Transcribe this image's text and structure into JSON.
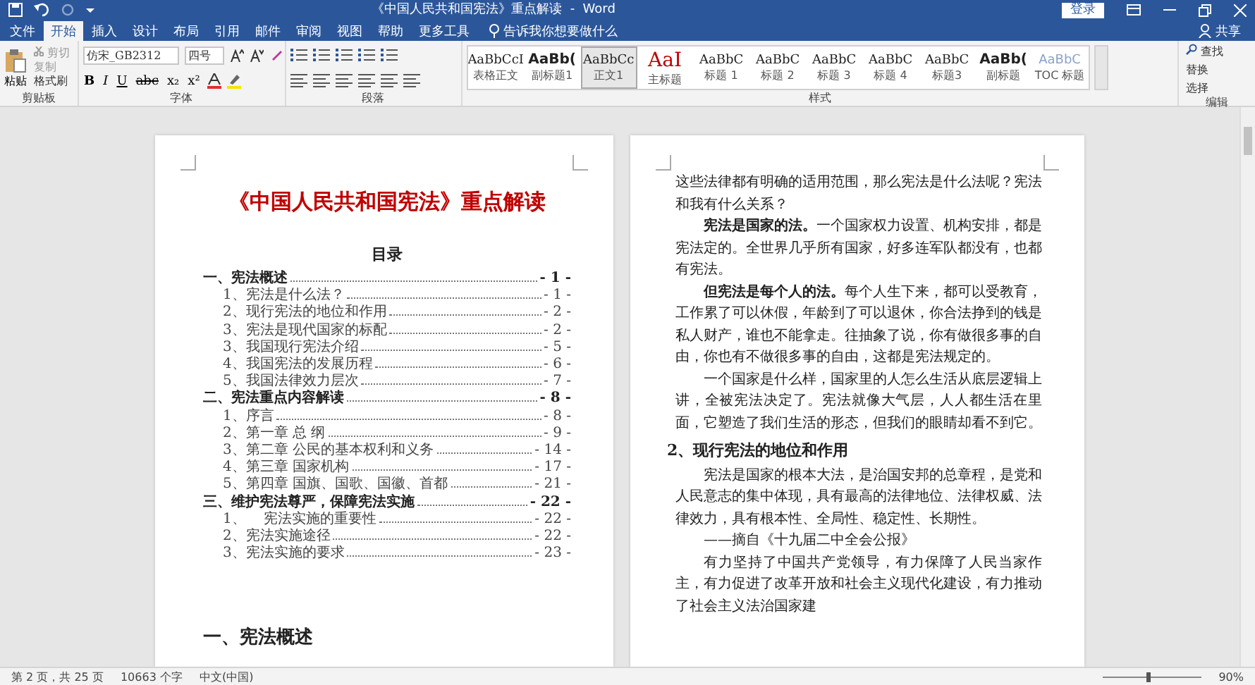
{
  "title_bar": {
    "title": "《中国人民共和国宪法》重点解读  -  Word",
    "login": "登录"
  },
  "tabs": [
    {
      "label": "文件",
      "selected": false
    },
    {
      "label": "开始",
      "selected": true
    },
    {
      "label": "插入",
      "selected": false
    },
    {
      "label": "设计",
      "selected": false
    },
    {
      "label": "布局",
      "selected": false
    },
    {
      "label": "引用",
      "selected": false
    },
    {
      "label": "邮件",
      "selected": false
    },
    {
      "label": "审阅",
      "selected": false
    },
    {
      "label": "视图",
      "selected": false
    },
    {
      "label": "帮助",
      "selected": false
    },
    {
      "label": "更多工具",
      "selected": false
    }
  ],
  "tell_me": "告诉我你想要做什么",
  "share": "共享",
  "ribbon": {
    "clipboard": {
      "paste": "粘贴",
      "cut": "剪切",
      "copy": "复制",
      "format_painter": "格式刷",
      "label": "剪贴板"
    },
    "font": {
      "name": "仿宋_GB2312",
      "size": "四号",
      "buttons": [
        "B",
        "I",
        "U",
        "abc",
        "x₂",
        "x²"
      ],
      "label": "字体"
    },
    "paragraph": {
      "label": "段落"
    },
    "styles": {
      "label": "样式",
      "items": [
        {
          "sample": "AaBbCcI",
          "name": "表格正文",
          "selected": false
        },
        {
          "sample": "AaBb(",
          "name": "副标题1",
          "selected": false
        },
        {
          "sample": "AaBbCc",
          "name": "正文1",
          "selected": true
        },
        {
          "sample": "AaI",
          "name": "主标题",
          "selected": false
        },
        {
          "sample": "AaBbC",
          "name": "标题 1",
          "selected": false
        },
        {
          "sample": "AaBbC",
          "name": "标题 2",
          "selected": false
        },
        {
          "sample": "AaBbC",
          "name": "标题 3",
          "selected": false
        },
        {
          "sample": "AaBbC",
          "name": "标题 4",
          "selected": false
        },
        {
          "sample": "AaBbC",
          "name": "标题3",
          "selected": false
        },
        {
          "sample": "AaBb(",
          "name": "副标题",
          "selected": false
        },
        {
          "sample": "AaBbC",
          "name": "TOC 标题",
          "selected": false
        }
      ]
    },
    "editing": {
      "find": "查找",
      "replace": "替换",
      "select": "选择",
      "label": "编辑"
    }
  },
  "left_page": {
    "title": "《中国人民共和国宪法》重点解读",
    "toc_heading": "目录",
    "toc": [
      {
        "text": "一、宪法概述",
        "page": "- 1 -",
        "children": [
          {
            "text": "1、宪法是什么法？",
            "page": "- 1 -"
          },
          {
            "text": "2、现行宪法的地位和作用",
            "page": "- 2 -"
          },
          {
            "text": "3、宪法是现代国家的标配",
            "page": "- 2 -"
          },
          {
            "text": "3、我国现行宪法介绍",
            "page": "- 5 -"
          },
          {
            "text": "4、我国宪法的发展历程",
            "page": "- 6 -"
          },
          {
            "text": "5、我国法律效力层次",
            "page": "- 7 -"
          }
        ]
      },
      {
        "text": "二、宪法重点内容解读",
        "page": "- 8 -",
        "children": [
          {
            "text": "1、序言",
            "page": "- 8 -"
          },
          {
            "text": "2、第一章 总 纲",
            "page": "- 9 -"
          },
          {
            "text": "3、第二章 公民的基本权利和义务",
            "page": "- 14 -"
          },
          {
            "text": "4、第三章 国家机构",
            "page": "- 17 -"
          },
          {
            "text": "5、第四章 国旗、国歌、国徽、首都",
            "page": "- 21 -"
          }
        ]
      },
      {
        "text": "三、维护宪法尊严，保障宪法实施",
        "page": "- 22 -",
        "children": [
          {
            "text": "1、    宪法实施的重要性",
            "page": "- 22 -"
          },
          {
            "text": "2、宪法实施途径",
            "page": "- 22 -"
          },
          {
            "text": "3、宪法实施的要求",
            "page": "- 23 -"
          }
        ]
      }
    ],
    "section_heading": "一、宪法概述"
  },
  "right_page": {
    "paragraphs": [
      {
        "kind": "continuation",
        "text": "这些法律都有明确的适用范围，那么宪法是什么法呢？宪法和我有什么关系？"
      },
      {
        "kind": "body",
        "text": "**宪法是国家的法。**一个国家权力设置、机构安排，都是宪法定的。全世界几乎所有国家，好多连军队都没有，也都有宪法。"
      },
      {
        "kind": "body",
        "text": "**但宪法是每个人的法。**每个人生下来，都可以受教育，工作累了可以休假，年龄到了可以退休，你合法挣到的钱是私人财产，谁也不能拿走。往抽象了说，你有做很多事的自由，你也有不做很多事的自由，这都是宪法规定的。"
      },
      {
        "kind": "body",
        "text": "一个国家是什么样，国家里的人怎么生活从底层逻辑上讲，全被宪法决定了。宪法就像大气层，人人都生活在里面，它塑造了我们生活的形态，但我们的眼睛却看不到它。"
      },
      {
        "kind": "heading",
        "text": "2、现行宪法的地位和作用"
      },
      {
        "kind": "body",
        "text": "宪法是国家的根本大法，是治国安邦的总章程，是党和人民意志的集中体现，具有最高的法律地位、法律权威、法律效力，具有根本性、全局性、稳定性、长期性。"
      },
      {
        "kind": "body",
        "text": "——摘自《十九届二中全会公报》"
      },
      {
        "kind": "body",
        "text": "有力坚持了中国共产党领导，有力保障了人民当家作主，有力促进了改革开放和社会主义现代化建设，有力推动了社会主义法治国家建"
      }
    ]
  },
  "status_bar": {
    "page": "第 2 页，共 25 页",
    "words": "10663 个字",
    "language": "中文(中国)",
    "zoom_slider": {
      "level": 0.45
    },
    "zoom": "90%"
  }
}
